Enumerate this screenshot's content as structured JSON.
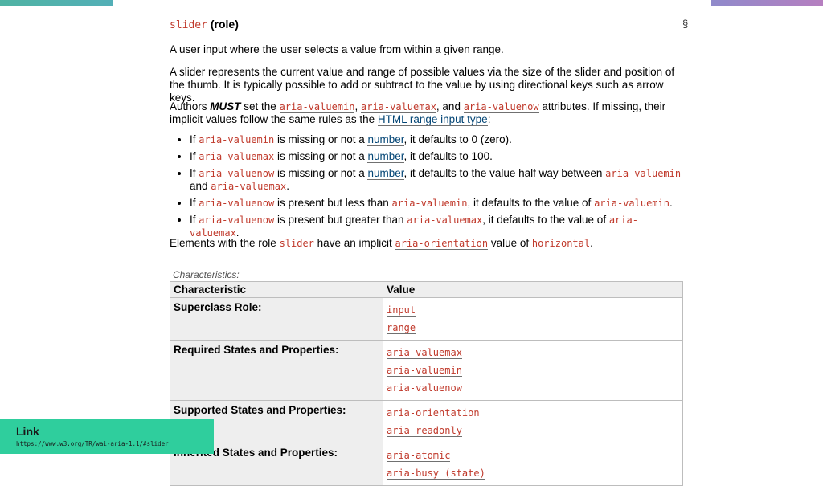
{
  "section": {
    "role_code": "slider",
    "role_suffix": "(role)",
    "section_mark": "§"
  },
  "para1": "A user input where the user selects a value from within a given range.",
  "para2": "A slider represents the current value and range of possible values via the size of the slider and position of the thumb. It is typically possible to add or subtract to the value by using directional keys such as arrow keys.",
  "para3": {
    "t1": "Authors ",
    "must": "MUST",
    "t2": " set the ",
    "c1": "aria-valuemin",
    "t3": ", ",
    "c2": "aria-valuemax",
    "t4": ", and ",
    "c3": "aria-valuenow",
    "t5": " attributes. If missing, their implicit values follow the same rules as the ",
    "link": "HTML range input type",
    "t6": ":"
  },
  "bullets": [
    {
      "a": "If ",
      "c1": "aria-valuemin",
      "b": " is missing or not a ",
      "link": "number",
      "c": ", it defaults to 0 (zero)."
    },
    {
      "a": "If ",
      "c1": "aria-valuemax",
      "b": " is missing or not a ",
      "link": "number",
      "c": ", it defaults to 100."
    },
    {
      "a": "If ",
      "c1": "aria-valuenow",
      "b": " is missing or not a ",
      "link": "number",
      "c": ", it defaults to the value half way between ",
      "c2": "aria-valuemin",
      "d": " and ",
      "c3": "aria-valuemax",
      "e": "."
    },
    {
      "a": "If ",
      "c1": "aria-valuenow",
      "b": " is present but less than ",
      "c2": "aria-valuemin",
      "c": ", it defaults to the value of ",
      "c3": "aria-valuemin",
      "d": "."
    },
    {
      "a": "If ",
      "c1": "aria-valuenow",
      "b": " is present but greater than ",
      "c2": "aria-valuemax",
      "c": ", it defaults to the value of ",
      "c3": "aria-valuemax",
      "d": "."
    }
  ],
  "para4": {
    "t1": "Elements with the role ",
    "c1": "slider",
    "t2": " have an implicit ",
    "c2": "aria-orientation",
    "t3": " value of ",
    "c3": "horizontal",
    "t4": "."
  },
  "table": {
    "caption": "Characteristics:",
    "headers": [
      "Characteristic",
      "Value"
    ],
    "rows": [
      {
        "key": "Superclass Role:",
        "values": [
          "input",
          "range"
        ]
      },
      {
        "key": "Required States and Properties:",
        "values": [
          "aria-valuemax",
          "aria-valuemin",
          "aria-valuenow"
        ]
      },
      {
        "key": "Supported States and Properties:",
        "values": [
          "aria-orientation",
          "aria-readonly"
        ]
      },
      {
        "key": "Inherited States and Properties:",
        "values": [
          "aria-atomic",
          "aria-busy (state)"
        ]
      }
    ]
  },
  "footer": {
    "title": "Link",
    "url": "https://www.w3.org/TR/wai-aria-1.1/#slider"
  }
}
